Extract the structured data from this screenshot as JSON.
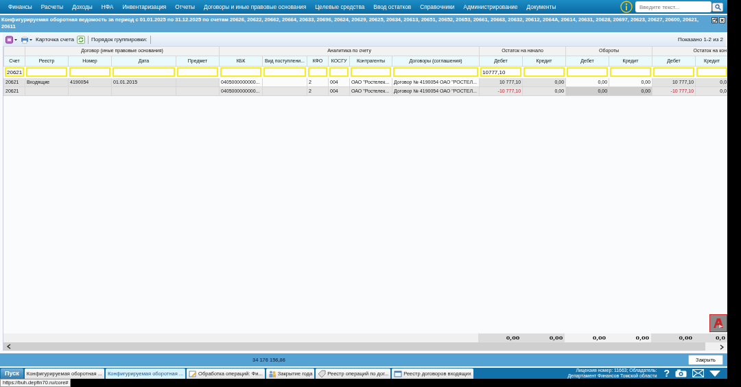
{
  "menu": [
    "Финансы",
    "Расчеты",
    "Доходы",
    "НФА",
    "Инвентаризация",
    "Отчеты",
    "Договоры и иные правовые основания",
    "Целевые средства",
    "Ввод остатков",
    "Справочники",
    "Администрирование",
    "Документы"
  ],
  "search": {
    "placeholder": "Введите текст..."
  },
  "window": {
    "title": "Конфигурируемая оборотная ведомость за период с 01.01.2025 по 31.12.2025 по счетам 20626, 20622, 20662, 20664, 20633, 20696, 20624, 20629, 20625, 20634, 20613, 20651, 20652, 20653, 20661, 20663, 20632, 20612, 2064А, 20614, 20631, 20628, 20697, 20623, 20627, 20600, 20621, 20611"
  },
  "toolbar": {
    "card_button": "Карточка счета",
    "grouping_label": "Порядок группировки:",
    "paging": "Показано 1-2 из 2"
  },
  "table": {
    "column_groups": [
      {
        "columns": [
          {
            "label": "Счет",
            "filter": "20621"
          }
        ]
      },
      {
        "label": "Договор (иные правовые основания)",
        "columns": [
          {
            "label": "Реестр"
          },
          {
            "label": "Номер"
          },
          {
            "label": "Дата"
          },
          {
            "label": "Предмет"
          }
        ]
      },
      {
        "label": "Аналитика по счету",
        "columns": [
          {
            "label": "КБК"
          },
          {
            "label": "Вид поступлени..."
          },
          {
            "label": "КФО"
          },
          {
            "label": "КОСГУ"
          },
          {
            "label": "Контрагенты"
          },
          {
            "label": "Договоры (соглашения)"
          }
        ]
      },
      {
        "label": "Остаток на начало",
        "columns": [
          {
            "label": "Дебет",
            "filter": "10777,10"
          },
          {
            "label": "Кредит"
          }
        ]
      },
      {
        "label": "Обороты",
        "columns": [
          {
            "label": "Дебет"
          },
          {
            "label": "Кредит"
          }
        ]
      },
      {
        "label": "Остаток на кон",
        "columns": [
          {
            "label": "Дебет"
          },
          {
            "label": "Кредит"
          }
        ]
      }
    ],
    "rows": [
      {
        "cells": [
          "20621",
          "Входящие",
          "4190054",
          "01.01.2015",
          null,
          "0405000000000...",
          null,
          "2",
          "004",
          "ОАО \"Ростелек...",
          "Договор № 4190054 ОАО \"РОСТЕЛ...",
          {
            "text": "10 777,10",
            "negative": false
          },
          {
            "text": "0,00",
            "negative": false
          },
          {
            "text": "0,00",
            "negative": false
          },
          {
            "text": "0,00",
            "negative": false
          },
          {
            "text": "10 777,10",
            "negative": false
          },
          {
            "text": "0,0",
            "negative": false
          }
        ]
      },
      {
        "cells": [
          "20621",
          null,
          null,
          null,
          null,
          "0405000000000...",
          null,
          "2",
          "004",
          "ОАО \"Ростелек...",
          "Договор № 4190054 ОАО \"РОСТЕЛ...",
          {
            "text": "-10 777,10",
            "negative": true
          },
          {
            "text": "0,00",
            "negative": false
          },
          {
            "text": "0,00",
            "negative": false
          },
          {
            "text": "0,00",
            "negative": false
          },
          {
            "text": "-10 777,10",
            "negative": true
          },
          {
            "text": "0,0",
            "negative": false
          }
        ]
      }
    ],
    "totals": [
      "0,00",
      "0,00",
      "0,00",
      "0,00",
      "0,00",
      "0,0"
    ]
  },
  "footer": {
    "grand_total": "34 176 156,86",
    "close_button": "Закрыть"
  },
  "taskbar": {
    "start": "Пуск",
    "tabs": [
      {
        "label": "Конфигурируемая оборотная ...",
        "selected": false,
        "kind": "plain"
      },
      {
        "label": "Конфигурируемая оборотная ...",
        "selected": true,
        "kind": "plain"
      },
      {
        "label": "Обработка операций: Фи...",
        "selected": false,
        "kind": "pencil"
      },
      {
        "label": "Закрытие года",
        "selected": false,
        "kind": "people"
      },
      {
        "label": "Реестр операций по дог...",
        "selected": false,
        "kind": "tag"
      },
      {
        "label": "Реестр договоров входящих",
        "selected": false,
        "kind": "window"
      }
    ],
    "license": [
      "Лицензия номер: 11663; Обладатель:",
      "Департамент Финансов Томской области"
    ],
    "help": "?"
  },
  "status_url": "https://buh.depfin70.ru/core#"
}
